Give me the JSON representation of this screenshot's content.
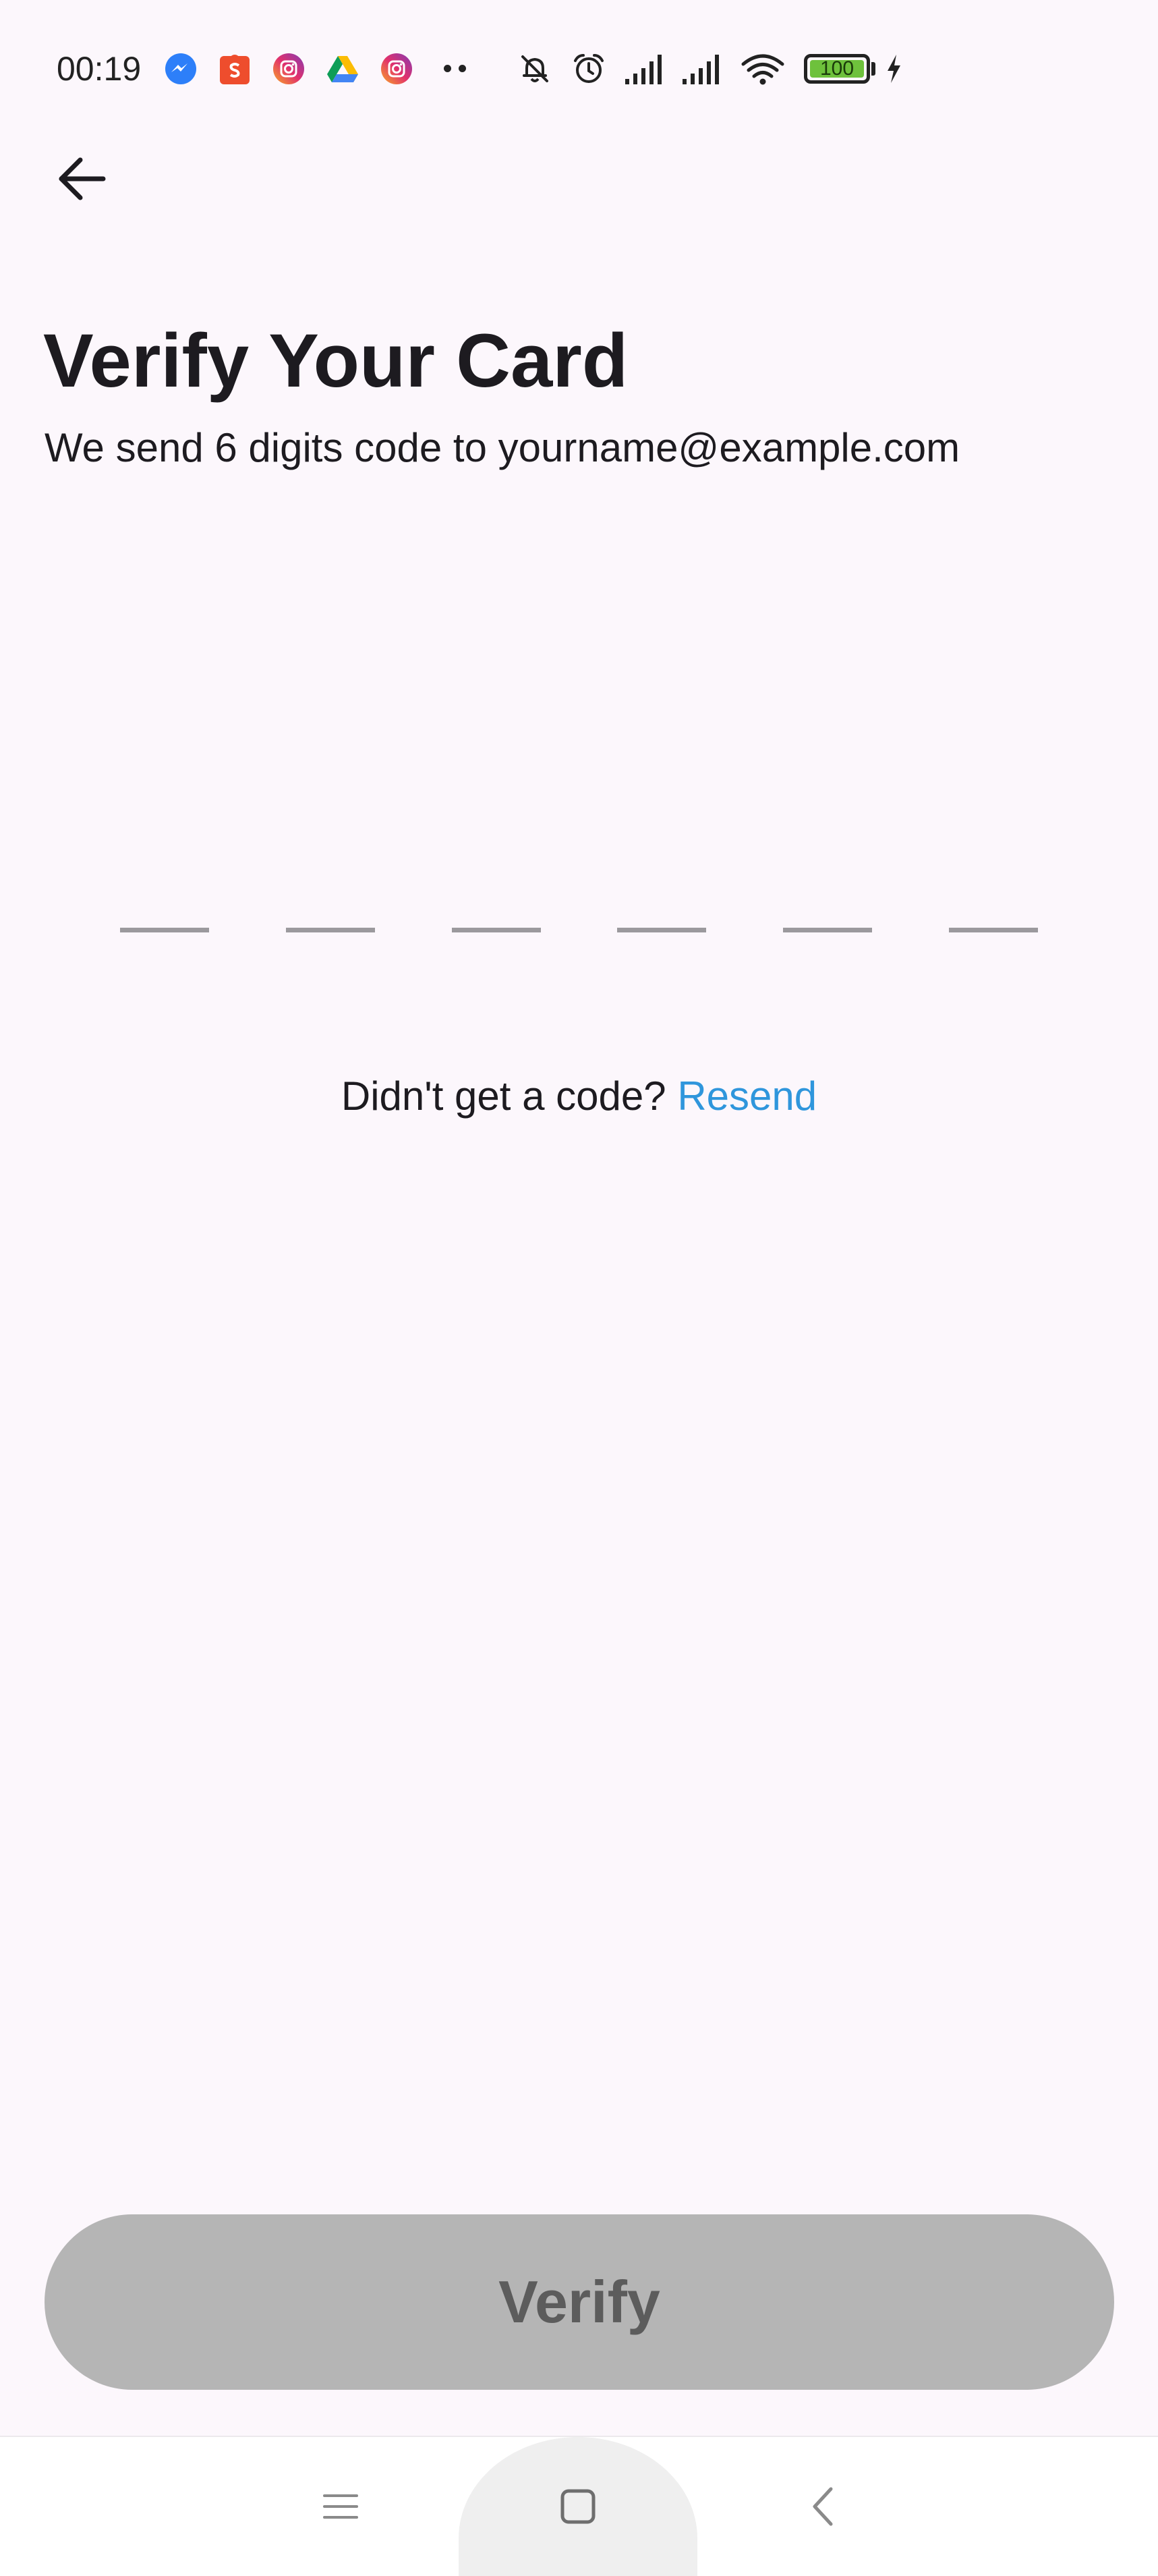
{
  "status_bar": {
    "time": "00:19",
    "battery_level": "100",
    "notification_icons": [
      "messenger-icon",
      "shopee-icon",
      "instagram-icon",
      "google-drive-icon",
      "instagram-icon",
      "more-dots-icon"
    ],
    "system_icons": [
      "muted-alarm-icon",
      "alarm-clock-icon",
      "signal-icon",
      "signal-icon",
      "wifi-icon",
      "battery-icon",
      "charging-icon"
    ]
  },
  "header": {
    "back_icon": "arrow-left-icon"
  },
  "page": {
    "title": "Verify Your Card",
    "subtitle": "We send 6 digits code to yourname@example.com"
  },
  "otp": {
    "length": 6,
    "digits": [
      "",
      "",
      "",
      "",
      "",
      ""
    ]
  },
  "resend": {
    "prompt": "Didn't get a code? ",
    "link_label": "Resend"
  },
  "verify_button": {
    "label": "Verify",
    "enabled": false
  },
  "nav_bar": {
    "icons": [
      "menu-icon",
      "home-icon",
      "back-chevron-icon"
    ]
  },
  "colors": {
    "background": "#fcf7fc",
    "link": "#2f96dc",
    "button_disabled_bg": "#b5b5b5",
    "button_disabled_text": "#5c5c5c",
    "otp_underline": "#9b999d",
    "battery_fill": "#6ec13c"
  }
}
